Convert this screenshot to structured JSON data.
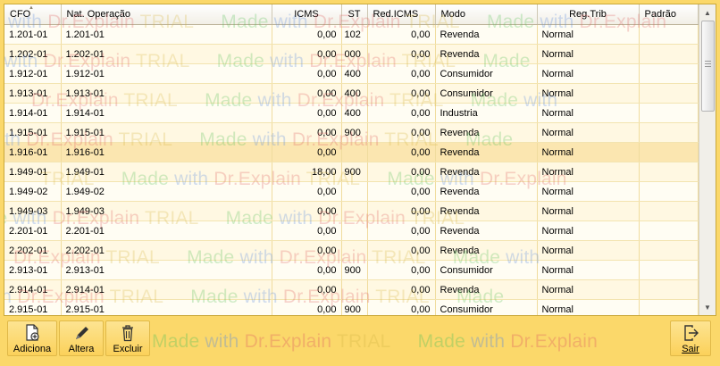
{
  "columns": {
    "cfo": "CFO",
    "nat": "Nat. Operação",
    "icms": "ICMS",
    "st": "ST",
    "red_icms": "Red.ICMS",
    "modo": "Modo",
    "reg_trib": "Reg.Trib",
    "padrao": "Padrão"
  },
  "rows": [
    {
      "cfo": "1.201-01",
      "nat": "1.201-01",
      "icms": "0,00",
      "st": "102",
      "red": "0,00",
      "modo": "Revenda",
      "reg": "Normal",
      "padrao": ""
    },
    {
      "cfo": "1.202-01",
      "nat": "1.202-01",
      "icms": "0,00",
      "st": "000",
      "red": "0,00",
      "modo": "Revenda",
      "reg": "Normal",
      "padrao": ""
    },
    {
      "cfo": "1.912-01",
      "nat": "1.912-01",
      "icms": "0,00",
      "st": "400",
      "red": "0,00",
      "modo": "Consumidor",
      "reg": "Normal",
      "padrao": ""
    },
    {
      "cfo": "1.913-01",
      "nat": "1.913-01",
      "icms": "0,00",
      "st": "400",
      "red": "0,00",
      "modo": "Consumidor",
      "reg": "Normal",
      "padrao": ""
    },
    {
      "cfo": "1.914-01",
      "nat": "1.914-01",
      "icms": "0,00",
      "st": "400",
      "red": "0,00",
      "modo": "Industria",
      "reg": "Normal",
      "padrao": ""
    },
    {
      "cfo": "1.915-01",
      "nat": "1.915-01",
      "icms": "0,00",
      "st": "900",
      "red": "0,00",
      "modo": "Revenda",
      "reg": "Normal",
      "padrao": ""
    },
    {
      "cfo": "1.916-01",
      "nat": "1.916-01",
      "icms": "0,00",
      "st": "",
      "red": "0,00",
      "modo": "Revenda",
      "reg": "Normal",
      "padrao": ""
    },
    {
      "cfo": "1.949-01",
      "nat": "1.949-01",
      "icms": "18,00",
      "st": "900",
      "red": "0,00",
      "modo": "Revenda",
      "reg": "Normal",
      "padrao": ""
    },
    {
      "cfo": "1.949-02",
      "nat": "1.949-02",
      "icms": "0,00",
      "st": "",
      "red": "0,00",
      "modo": "Revenda",
      "reg": "Normal",
      "padrao": ""
    },
    {
      "cfo": "1.949-03",
      "nat": "1.949-03",
      "icms": "0,00",
      "st": "",
      "red": "0,00",
      "modo": "Revenda",
      "reg": "Normal",
      "padrao": ""
    },
    {
      "cfo": "2.201-01",
      "nat": "2.201-01",
      "icms": "0,00",
      "st": "",
      "red": "0,00",
      "modo": "Revenda",
      "reg": "Normal",
      "padrao": ""
    },
    {
      "cfo": "2.202-01",
      "nat": "2.202-01",
      "icms": "0,00",
      "st": "",
      "red": "0,00",
      "modo": "Revenda",
      "reg": "Normal",
      "padrao": ""
    },
    {
      "cfo": "2.913-01",
      "nat": "2.913-01",
      "icms": "0,00",
      "st": "900",
      "red": "0,00",
      "modo": "Consumidor",
      "reg": "Normal",
      "padrao": ""
    },
    {
      "cfo": "2.914-01",
      "nat": "2.914-01",
      "icms": "0,00",
      "st": "",
      "red": "0,00",
      "modo": "Revenda",
      "reg": "Normal",
      "padrao": ""
    },
    {
      "cfo": "2.915-01",
      "nat": "2.915-01",
      "icms": "0,00",
      "st": "900",
      "red": "0,00",
      "modo": "Consumidor",
      "reg": "Normal",
      "padrao": ""
    }
  ],
  "selected_row": "1.916-01",
  "toolbar": {
    "add_label": "Adiciona",
    "edit_label": "Altera",
    "delete_label": "Excluir",
    "exit_label": "Sair"
  },
  "watermark": {
    "text_1": "Dr.Explain",
    "text_2": "TRIAL",
    "text_3": "Made",
    "text_4": "with"
  },
  "icons": {
    "add": "document-plus-icon",
    "edit": "pencil-icon",
    "delete": "trash-icon",
    "exit": "exit-door-icon"
  }
}
